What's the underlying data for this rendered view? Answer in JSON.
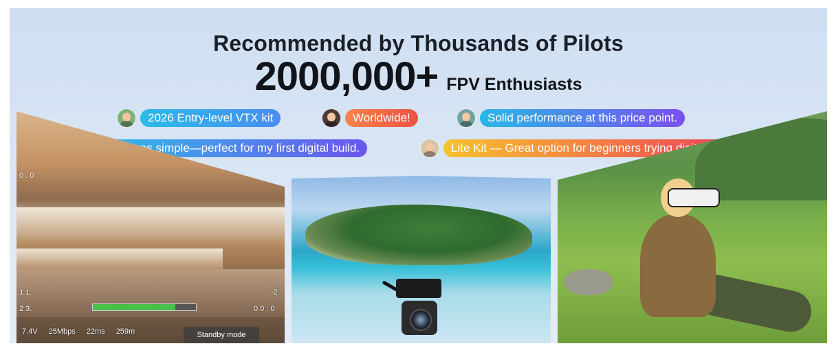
{
  "headline": "Recommended by Thousands of Pilots",
  "stat": {
    "number": "2000,000+",
    "label": "FPV Enthusiasts"
  },
  "reviews": [
    {
      "text": "2026 Entry-level VTX kit",
      "color": "#27b4e8"
    },
    {
      "text": "Worldwide!",
      "color": "#f36b45"
    },
    {
      "text": "Solid performance at this price point.",
      "color": "#3f86ee"
    },
    {
      "text": ". Setup was simple—perfect for my first digital build.",
      "color": "#3ca0f0"
    },
    {
      "text": "Lite Kit — Great option for beginners trying digital FPV.",
      "color": "#f38b2a"
    }
  ],
  "review_gradients": {
    "r0": [
      "#2bbbe8",
      "#4a8cf3"
    ],
    "r1": [
      "#f6844b",
      "#ee5144"
    ],
    "r2": [
      "#28b8e6",
      "#7b4ff0"
    ],
    "r3": [
      "#2fc1e8",
      "#6b56ee"
    ],
    "r4": [
      "#f7c12d",
      "#ef3f5a"
    ]
  },
  "osd": {
    "top_left": "0 . 0",
    "line1": "1 1.",
    "line2": "2 3.",
    "right1": "-2",
    "right2": "0 0 : 0",
    "voltage": "7.4V",
    "bitrate": "25Mbps",
    "latency": "22ms",
    "distance": "259m",
    "standby": "Standby mode",
    "signal_level": 0.8
  }
}
